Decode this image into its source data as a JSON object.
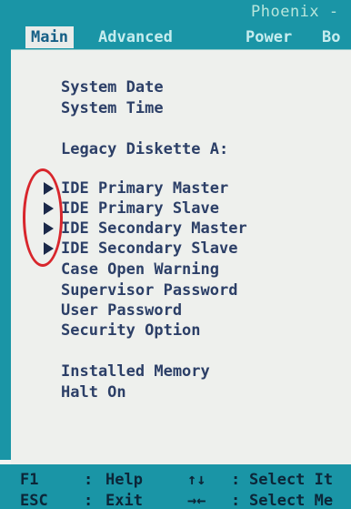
{
  "header": {
    "vendor": "Phoenix -"
  },
  "tabs": [
    {
      "label": "Main",
      "active": true
    },
    {
      "label": "Advanced",
      "active": false
    },
    {
      "label": "Power",
      "active": false
    },
    {
      "label": "Bo",
      "active": false
    }
  ],
  "items": [
    {
      "label": "System Date",
      "submenu": false
    },
    {
      "label": "System Time",
      "submenu": false
    },
    {
      "label": "Legacy Diskette A:",
      "submenu": false
    },
    {
      "label": "IDE Primary Master",
      "submenu": true
    },
    {
      "label": "IDE Primary Slave",
      "submenu": true
    },
    {
      "label": "IDE Secondary Master",
      "submenu": true
    },
    {
      "label": "IDE Secondary Slave",
      "submenu": true
    },
    {
      "label": "Case Open Warning",
      "submenu": false
    },
    {
      "label": "Supervisor Password",
      "submenu": false
    },
    {
      "label": "User Password",
      "submenu": false
    },
    {
      "label": "Security Option",
      "submenu": false
    },
    {
      "label": "Installed Memory",
      "submenu": false
    },
    {
      "label": "Halt On",
      "submenu": false
    }
  ],
  "status": {
    "row1": {
      "key": "F1",
      "action": "Help",
      "symbol": "↑↓",
      "desc": "Select It"
    },
    "row2": {
      "key": "ESC",
      "action": "Exit",
      "symbol": "→←",
      "desc": "Select Me"
    }
  },
  "colors": {
    "bios_cyan": "#1a95a6",
    "panel": "#eef0ed",
    "item_text": "#2c3f67",
    "annotation_red": "#d8262c"
  }
}
